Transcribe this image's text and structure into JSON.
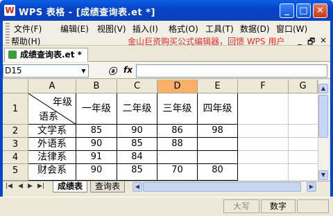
{
  "window": {
    "app_icon": "W",
    "title": "WPS 表格 - [成绩查询表.et *]",
    "min": "_",
    "max": "□",
    "close": "✕"
  },
  "menu": {
    "items": [
      "文件(F)",
      "编辑(E)",
      "视图(V)",
      "插入(I)",
      "格式(O)",
      "工具(T)",
      "数据(D)",
      "窗口(W)"
    ],
    "help": "帮助(H)",
    "promo": "金山巨资购买公式编辑器，回馈 WPS 用户",
    "doc_min": "_",
    "doc_restore": "🗗",
    "doc_close": "×"
  },
  "doc_tab": {
    "label": "成绩查询表.et *"
  },
  "formula_bar": {
    "cell_ref": "D15",
    "value": "",
    "fx_label": "fx"
  },
  "sheet": {
    "columns": [
      "A",
      "B",
      "C",
      "D",
      "E",
      "F",
      "G"
    ],
    "selected_column": "D",
    "rows": [
      "1",
      "2",
      "3",
      "4",
      "5"
    ],
    "header_corner": {
      "top_right": "年级",
      "bottom_left": "语系"
    },
    "cells": [
      [
        "",
        "一年级",
        "二年级",
        "三年级",
        "四年级",
        "",
        ""
      ],
      [
        "文学系",
        "85",
        "90",
        "86",
        "98",
        "",
        ""
      ],
      [
        "外语系",
        "90",
        "85",
        "88",
        "",
        "",
        ""
      ],
      [
        "法律系",
        "91",
        "84",
        "",
        "",
        "",
        ""
      ],
      [
        "财会系",
        "90",
        "85",
        "70",
        "80",
        "",
        ""
      ]
    ]
  },
  "sheet_tabs": [
    "成绩表",
    "查询表"
  ],
  "active_sheet": "成绩表",
  "status": {
    "caps": "大写",
    "num": "数字"
  }
}
